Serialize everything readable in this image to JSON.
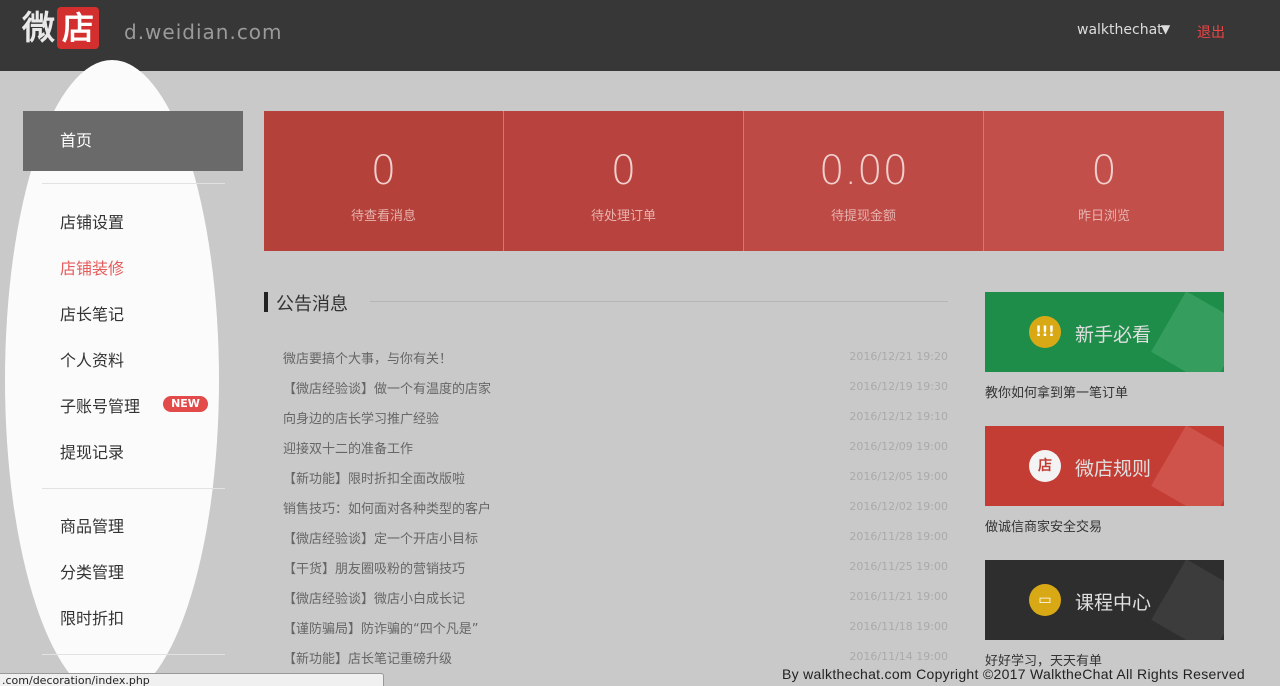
{
  "header": {
    "logo_wei": "微",
    "logo_dian": "店",
    "domain": "d.weidian.com",
    "username": "walkthechat",
    "logout": "退出"
  },
  "sidebar": {
    "home": "首页",
    "group1": [
      "店铺设置",
      "店铺装修",
      "店长笔记",
      "个人资料",
      "子账号管理",
      "提现记录"
    ],
    "badge_new": "NEW",
    "group2": [
      "商品管理",
      "分类管理",
      "限时折扣"
    ]
  },
  "stats": [
    {
      "value": "0",
      "label": "待查看消息"
    },
    {
      "value": "0",
      "label": "待处理订单"
    },
    {
      "value": "0.00",
      "label": "待提现金额"
    },
    {
      "value": "0",
      "label": "昨日浏览"
    }
  ],
  "announcements": {
    "title": "公告消息",
    "items": [
      {
        "title": "微店要搞个大事，与你有关！",
        "date": "2016/12/21 19:20"
      },
      {
        "title": "【微店经验谈】做一个有温度的店家",
        "date": "2016/12/19 19:30"
      },
      {
        "title": "向身边的店长学习推广经验",
        "date": "2016/12/12 19:10"
      },
      {
        "title": "迎接双十二的准备工作",
        "date": "2016/12/09 19:00"
      },
      {
        "title": "【新功能】限时折扣全面改版啦",
        "date": "2016/12/05 19:00"
      },
      {
        "title": "销售技巧：如何面对各种类型的客户",
        "date": "2016/12/02 19:00"
      },
      {
        "title": "【微店经验谈】定一个开店小目标",
        "date": "2016/11/28 19:00"
      },
      {
        "title": "【干货】朋友圈吸粉的营销技巧",
        "date": "2016/11/25 19:00"
      },
      {
        "title": "【微店经验谈】微店小白成长记",
        "date": "2016/11/21 19:00"
      },
      {
        "title": "【谨防骗局】防诈骗的“四个凡是”",
        "date": "2016/11/18 19:00"
      },
      {
        "title": "【新功能】店长笔记重磅升级",
        "date": "2016/11/14 19:00"
      }
    ]
  },
  "promos": [
    {
      "icon_text": "!!!",
      "title": "新手必看",
      "caption": "教你如何拿到第一笔订单",
      "bg": "#1f8d4a",
      "icon_bg": "#d9a915"
    },
    {
      "icon_text": "店",
      "title": "微店规则",
      "caption": "做诚信商家安全交易",
      "bg": "#c43d35",
      "icon_bg": "#f3f3f3"
    },
    {
      "icon_text": "▭",
      "title": "课程中心",
      "caption": "好好学习，天天有单",
      "bg": "#2e2e2e",
      "icon_bg": "#d9a915"
    }
  ],
  "footer": {
    "status_url": ".com/decoration/index.php",
    "copyright": "By walkthechat.com Copyright ©2017 WalktheChat All Rights Reserved"
  }
}
